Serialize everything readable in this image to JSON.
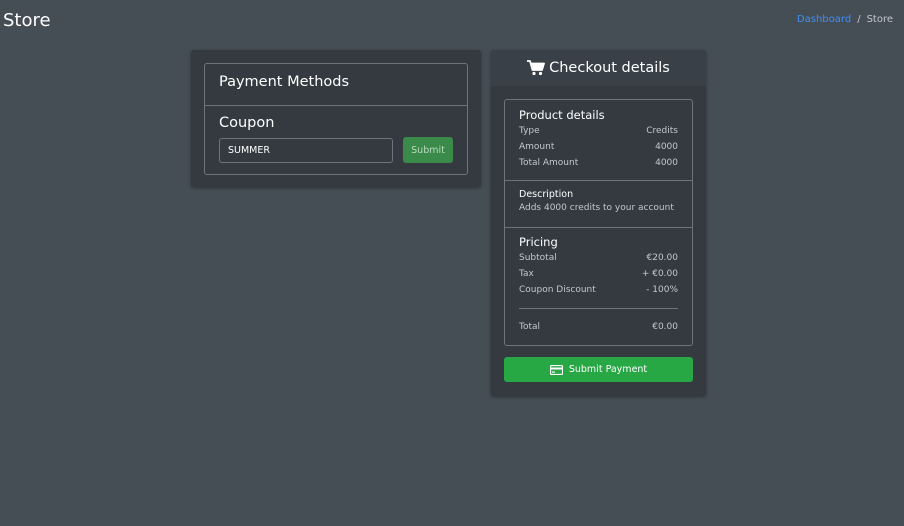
{
  "header": {
    "title": "Store",
    "breadcrumb": {
      "items": [
        "Dashboard",
        "Store"
      ],
      "separator": "/"
    }
  },
  "payment": {
    "title": "Payment Methods",
    "coupon_label": "Coupon",
    "coupon_value": "SUMMER",
    "submit_label": "Submit"
  },
  "checkout": {
    "title": "Checkout details",
    "icon": "shopping-cart-icon",
    "product": {
      "title": "Product details",
      "rows": [
        {
          "label": "Type",
          "value": "Credits"
        },
        {
          "label": "Amount",
          "value": "4000"
        },
        {
          "label": "Total Amount",
          "value": "4000"
        }
      ]
    },
    "description": {
      "title": "Description",
      "text": "Adds 4000 credits to your account"
    },
    "pricing": {
      "title": "Pricing",
      "rows": [
        {
          "label": "Subtotal",
          "value": "€20.00"
        },
        {
          "label": "Tax",
          "value": "+ €0.00"
        },
        {
          "label": "Coupon Discount",
          "value": "- 100%"
        }
      ],
      "total_label": "Total",
      "total_value": "€0.00"
    },
    "submit_label": "Submit Payment",
    "submit_icon": "credit-card-icon"
  },
  "colors": {
    "background": "#454d55",
    "card": "#343a40",
    "link": "#3f8ff7",
    "success": "#28a745"
  }
}
